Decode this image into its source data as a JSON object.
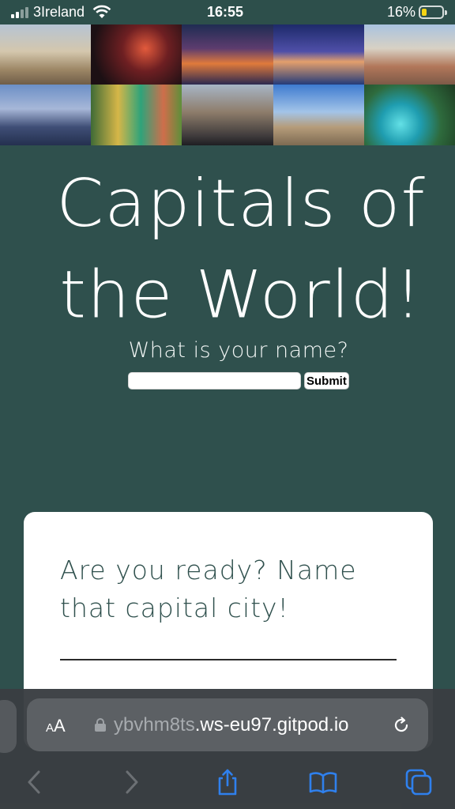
{
  "status_bar": {
    "carrier": "3Ireland",
    "time": "16:55",
    "battery_percent": "16%",
    "battery_level": 0.16
  },
  "collage": {
    "tiles": 10
  },
  "hero": {
    "title_line1": "Capitals of",
    "title_line2": "the World!"
  },
  "name_form": {
    "prompt": "What is your name?",
    "input_value": "",
    "submit_label": "Submit"
  },
  "quiz": {
    "heading_line1": "Are you ready? Name",
    "heading_line2": "that capital city!"
  },
  "browser": {
    "text_size_small": "A",
    "text_size_large": "A",
    "url_prefix": "ybvhm8ts",
    "url_rest": ".ws-eu97.gitpod.io",
    "accent_color": "#2f80ed",
    "disabled_color": "#6c7074"
  }
}
